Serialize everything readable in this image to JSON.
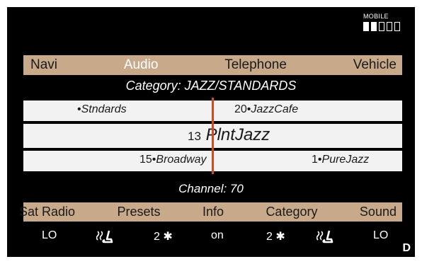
{
  "status": {
    "mobile_label": "MOBILE",
    "signal_bars_filled": 2,
    "signal_bars_total": 5
  },
  "top_menu": {
    "items": [
      "Navi",
      "Audio",
      "Telephone",
      "Vehicle"
    ],
    "active": "Audio"
  },
  "category_line": "Category: JAZZ/STANDARDS",
  "stations": {
    "row1_left": {
      "name": "Stndards"
    },
    "row1_right": {
      "number": "20",
      "name": "JazzCafe"
    },
    "current": {
      "number": "13",
      "name": "PlntJazz"
    },
    "row3_left": {
      "number": "15",
      "name": "Broadway"
    },
    "row3_right": {
      "number": "1",
      "name": "PureJazz"
    },
    "bullet": "•"
  },
  "channel_line": "Channel: 70",
  "bottom_menu": {
    "items": [
      "Sat Radio",
      "Presets",
      "Info",
      "Category",
      "Sound"
    ]
  },
  "bottom_values": {
    "left_heat": "LO",
    "left_fan": "2",
    "info": "on",
    "right_fan": "2",
    "right_heat": "LO",
    "fan_glyph": "✱"
  },
  "corner_label": "D",
  "colors": {
    "bar_bg": "#c8a98a",
    "list_bg": "#f2f2f2",
    "tuner_line": "#d8471f",
    "screen_bg": "#000000"
  }
}
